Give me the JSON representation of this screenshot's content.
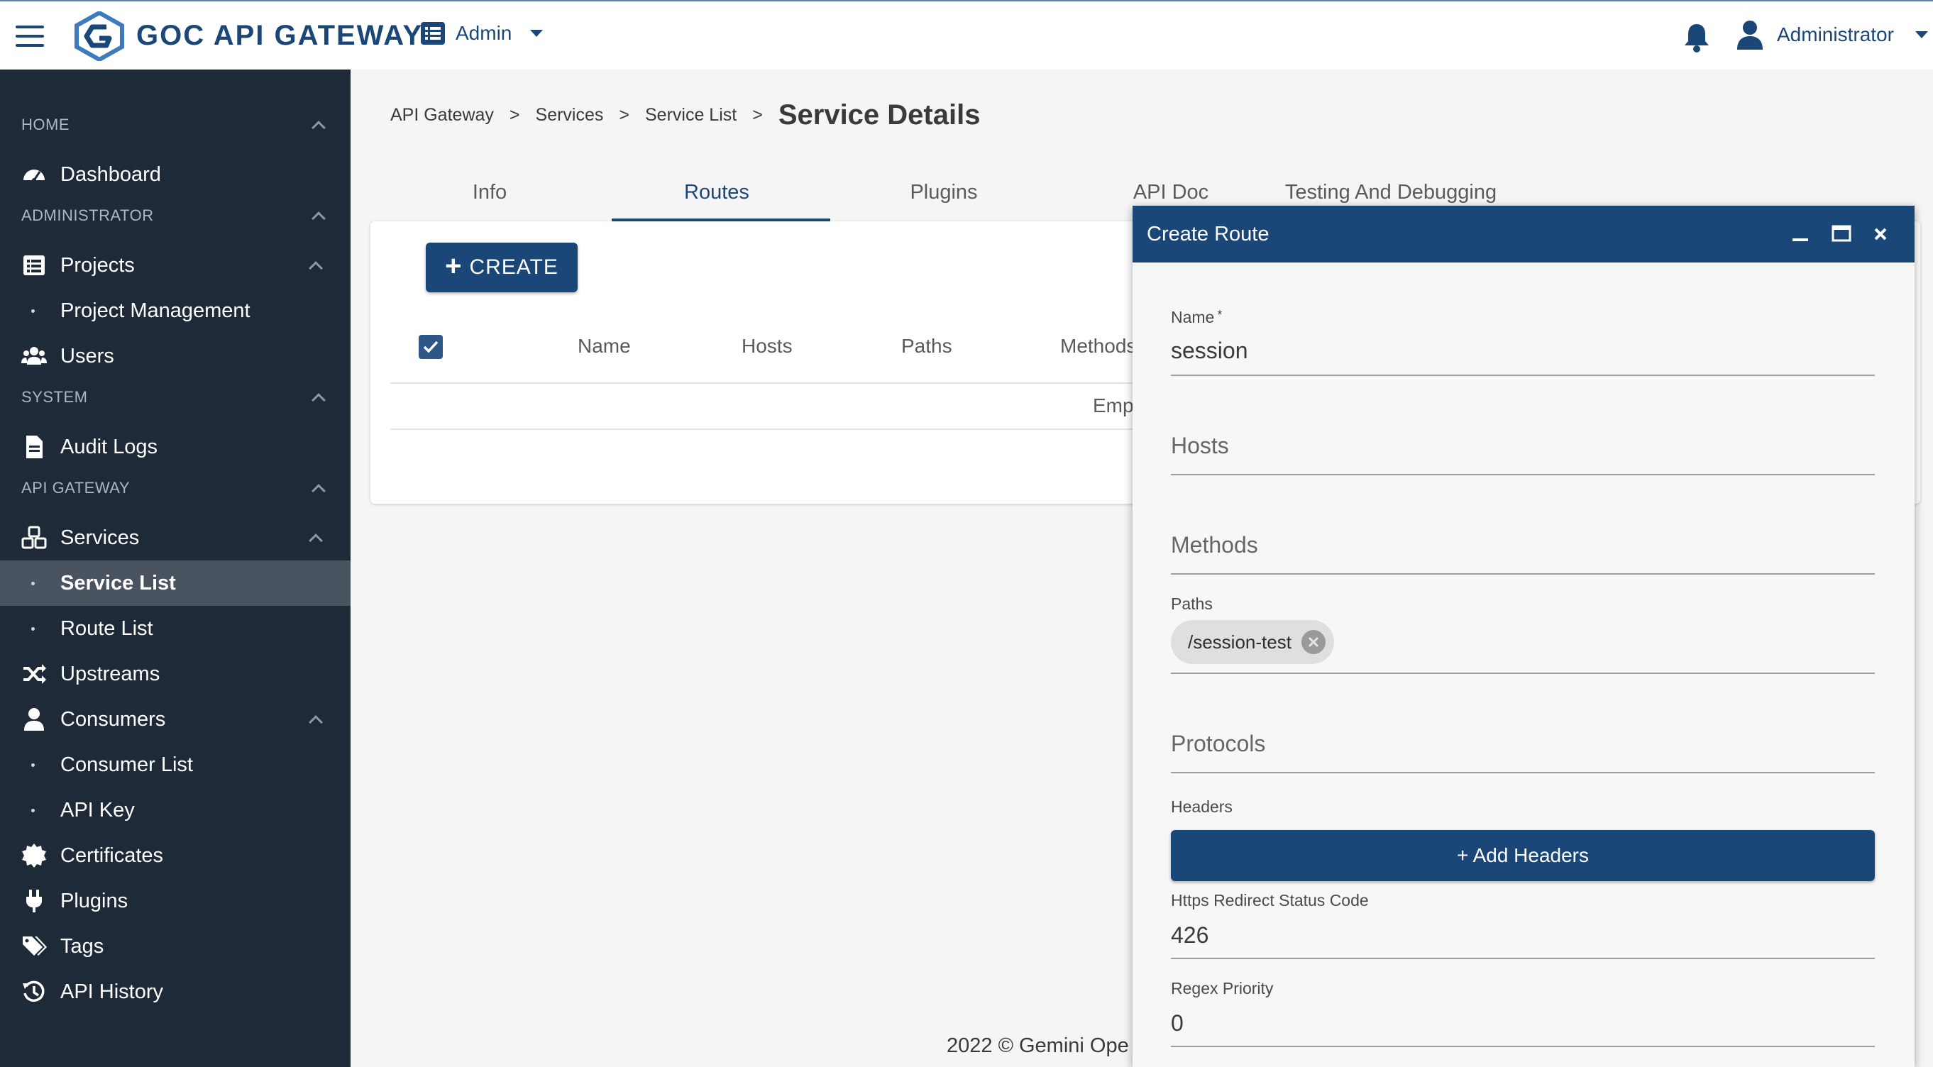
{
  "header": {
    "brand": "GOC API GATEWAY",
    "role_switch": "Admin",
    "user_name": "Administrator"
  },
  "sidebar": {
    "sections": [
      {
        "label": "HOME"
      },
      {
        "label": "ADMINISTRATOR"
      },
      {
        "label": "SYSTEM"
      },
      {
        "label": "API GATEWAY"
      }
    ],
    "items": [
      {
        "label": "Dashboard",
        "icon": "dashboard-icon"
      },
      {
        "label": "Projects",
        "icon": "list-icon"
      },
      {
        "label": "Project Management"
      },
      {
        "label": "Users",
        "icon": "users-icon"
      },
      {
        "label": "Audit Logs",
        "icon": "document-icon"
      },
      {
        "label": "Services",
        "icon": "cubes-icon"
      },
      {
        "label": "Service List"
      },
      {
        "label": "Route List"
      },
      {
        "label": "Upstreams",
        "icon": "shuffle-icon"
      },
      {
        "label": "Consumers",
        "icon": "user-icon"
      },
      {
        "label": "Consumer List"
      },
      {
        "label": "API Key"
      },
      {
        "label": "Certificates",
        "icon": "certificate-icon"
      },
      {
        "label": "Plugins",
        "icon": "plug-icon"
      },
      {
        "label": "Tags",
        "icon": "tags-icon"
      },
      {
        "label": "API History",
        "icon": "history-icon"
      }
    ],
    "active_item": "Service List"
  },
  "breadcrumb": {
    "items": [
      "API Gateway",
      "Services",
      "Service List"
    ],
    "separator": ">",
    "title": "Service Details"
  },
  "tabs": [
    {
      "label": "Info"
    },
    {
      "label": "Routes"
    },
    {
      "label": "Plugins"
    },
    {
      "label": "API Doc"
    },
    {
      "label": "Testing And Debugging"
    }
  ],
  "active_tab": "Routes",
  "routes_table": {
    "create_label": "CREATE",
    "columns": [
      "Name",
      "Hosts",
      "Paths",
      "Methods"
    ],
    "empty_text": "Emp"
  },
  "footer": {
    "text": "2022 © Gemini Ope"
  },
  "dialog": {
    "title": "Create Route",
    "name_label": "Name",
    "name_required_mark": "*",
    "name_value": "session",
    "hosts_placeholder": "Hosts",
    "methods_placeholder": "Methods",
    "paths_label": "Paths",
    "paths_chips": [
      "/session-test"
    ],
    "protocols_placeholder": "Protocols",
    "headers_label": "Headers",
    "add_headers_label": "+ Add Headers",
    "https_redirect_label": "Https Redirect Status Code",
    "https_redirect_value": "426",
    "regex_priority_label": "Regex Priority",
    "regex_priority_value": "0"
  },
  "colors": {
    "primary": "#1b4778",
    "sidebar_bg": "#1e2a38",
    "sidebar_active": "#4a5360"
  }
}
